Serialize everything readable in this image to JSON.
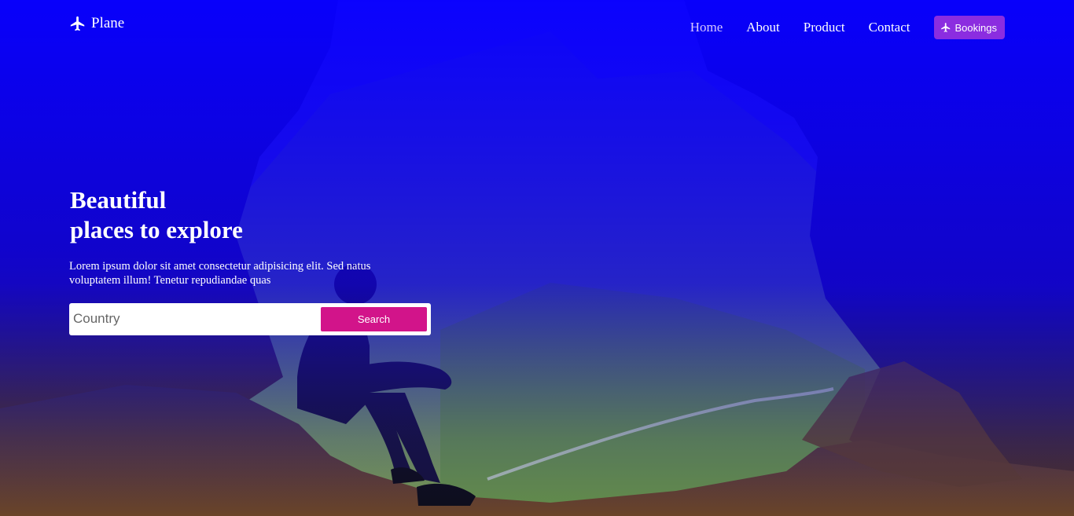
{
  "brand": {
    "name": "Plane",
    "icon": "airplane-icon"
  },
  "nav": {
    "items": [
      {
        "label": "Home",
        "active": true
      },
      {
        "label": "About",
        "active": false
      },
      {
        "label": "Product",
        "active": false
      },
      {
        "label": "Contact",
        "active": false
      }
    ],
    "bookings_label": "Bookings"
  },
  "hero": {
    "title_line1": "Beautiful",
    "title_line2": "places to explore",
    "subtitle": "Lorem ipsum dolor sit amet consectetur adipisicing elit. Sed natus voluptatem illum! Tenetur repudiandae quas",
    "search": {
      "placeholder": "Country",
      "value": "",
      "button_label": "Search"
    }
  },
  "colors": {
    "overlay": "#0a00ff",
    "bookings_button": "#8b2de0",
    "search_button": "#d2148a",
    "active_nav": "#d8c8ff"
  }
}
